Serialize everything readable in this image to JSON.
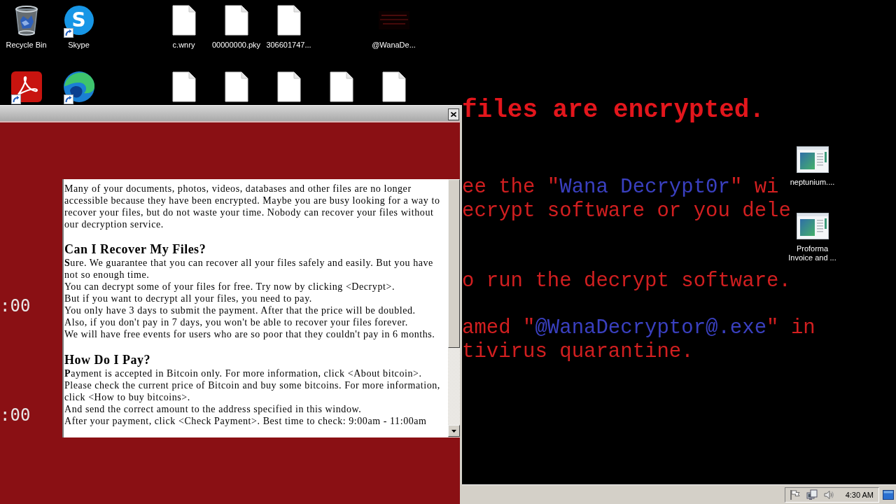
{
  "desktop": {
    "icons": [
      {
        "label": "Recycle Bin",
        "kind": "recycle-bin",
        "shortcut": false
      },
      {
        "label": "Skype",
        "kind": "chat-app",
        "glyph": "S",
        "shortcut": true
      },
      {
        "label": "c.wnry",
        "kind": "file",
        "shortcut": false
      },
      {
        "label": "00000000.pky",
        "kind": "file",
        "shortcut": false
      },
      {
        "label": "306601747...",
        "kind": "file",
        "shortcut": false
      },
      {
        "label": "@WanaDe...",
        "kind": "wallpaper-image",
        "shortcut": false
      },
      {
        "kind": "pdf-app",
        "shortcut": true
      },
      {
        "kind": "browser-app",
        "shortcut": true
      },
      {
        "kind": "file",
        "shortcut": false
      },
      {
        "kind": "file",
        "shortcut": false
      },
      {
        "kind": "file",
        "shortcut": false
      },
      {
        "kind": "file",
        "shortcut": false
      },
      {
        "kind": "file",
        "shortcut": false
      }
    ],
    "right_icons": [
      {
        "label": "neptunium....",
        "kind": "window-image",
        "shortcut": false
      },
      {
        "label": "Proforma Invoice and ...",
        "kind": "window-image",
        "shortcut": false
      }
    ]
  },
  "wallpaper": {
    "lines": [
      {
        "parts": [
          {
            "text": "files are encrypted.",
            "color": "#e3161c"
          }
        ]
      },
      {
        "parts": [
          {
            "text": "ee the \"",
            "color": "#d21f20"
          },
          {
            "text": "Wana Decrypt0r",
            "color": "#3a40c0"
          },
          {
            "text": "\" wi",
            "color": "#d21f20"
          }
        ]
      },
      {
        "parts": [
          {
            "text": "ecrypt software or you dele",
            "color": "#d21f20"
          }
        ]
      },
      {
        "parts": [
          {
            "text": "o run the decrypt software.",
            "color": "#d21f20"
          }
        ]
      },
      {
        "parts": [
          {
            "text": "amed \"",
            "color": "#d21f20"
          },
          {
            "text": "@WanaDecryptor@.exe",
            "color": "#3a40c0"
          },
          {
            "text": "\" in",
            "color": "#d21f20"
          }
        ]
      },
      {
        "parts": [
          {
            "text": "tivirus quarantine.",
            "color": "#d21f20"
          }
        ]
      }
    ]
  },
  "window": {
    "timers": [
      ":00",
      ":00"
    ],
    "sections": [
      {
        "paragraphs": [
          "Many of your documents, photos, videos, databases and other files are no longer accessible because they have been encrypted. Maybe you are busy looking for a way to recover your files, but do not waste your time. Nobody can recover your files without our decryption service."
        ]
      },
      {
        "heading": "Can I Recover My Files?",
        "paragraphs": [
          "**S**ure. We guarantee that you can recover all your files safely and easily. But you have not so enough time.",
          "You can decrypt some of your files for free. Try now by clicking <Decrypt>.",
          "But if you want to decrypt all your files, you need to pay.",
          "You only have 3 days to submit the payment. After that the price will be doubled.",
          "Also, if you don't pay in 7 days, you won't be able to recover your files forever.",
          "We will have free events for users who are so poor that they couldn't pay in 6 months."
        ]
      },
      {
        "heading": "How Do I Pay?",
        "paragraphs": [
          "**P**ayment is accepted in Bitcoin only. For more information, click <About bitcoin>.",
          "Please check the current price of Bitcoin and buy some bitcoins. For more information, click <How to buy bitcoins>.",
          "And send the correct amount to the address specified in this window.",
          "After your payment, click <Check Payment>. Best time to check: 9:00am - 11:00am"
        ]
      }
    ]
  },
  "taskbar": {
    "clock": "4:30 AM"
  }
}
